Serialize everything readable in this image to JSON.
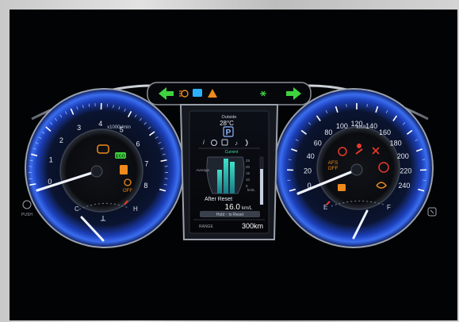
{
  "tachometer": {
    "unit_label": "x1000r/min",
    "ticks": [
      "0",
      "1",
      "2",
      "3",
      "4",
      "5",
      "6",
      "7",
      "8"
    ],
    "temp_cold": "C",
    "temp_hot": "H",
    "eco_badge": "ECO",
    "vsc_label": "OFF"
  },
  "speedometer": {
    "unit_label": "km/h",
    "ticks": [
      "0",
      "20",
      "40",
      "60",
      "80",
      "100",
      "120",
      "140",
      "160",
      "180",
      "200",
      "220",
      "240"
    ],
    "fuel_empty": "E",
    "fuel_full": "F",
    "afs_line1": "AFS",
    "afs_line2": "OFF"
  },
  "center_display": {
    "outside_label": "Outside",
    "outside_temp": "28°C",
    "park_symbol": "P",
    "gauge_current": "Current",
    "gauge_left_label": "Average",
    "gauge_scale": [
      "25",
      "20",
      "15",
      "10",
      "5"
    ],
    "gauge_unit": "km/L",
    "after_reset_label": "After Reset",
    "after_reset_value": "16.0",
    "after_reset_unit": "km/L",
    "hold_button": "Hold ↑ to Reset",
    "range_label": "RANGE",
    "range_value": "300km",
    "fuel_level_fraction": 0.75
  },
  "side_left": {
    "plus_label": "PUSH"
  },
  "colors": {
    "ring_blue": "#2a5bd8",
    "green_arrow": "#3fd23f",
    "warn_orange": "#f08a1c",
    "warn_red": "#e83a2a",
    "blue_lamp": "#2ab0ff",
    "needle": "#e8f0ff"
  }
}
